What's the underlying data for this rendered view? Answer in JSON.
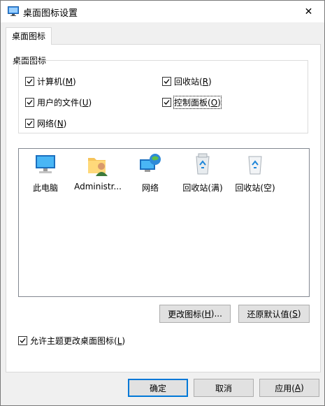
{
  "window": {
    "title": "桌面图标设置",
    "close_glyph": "✕"
  },
  "tabs": [
    {
      "label": "桌面图标"
    }
  ],
  "group": {
    "legend": "桌面图标",
    "checkboxes": [
      {
        "label": "计算机(",
        "key": "M",
        "tail": ")",
        "checked": true
      },
      {
        "label": "回收站(",
        "key": "R",
        "tail": ")",
        "checked": true
      },
      {
        "label": "用户的文件(",
        "key": "U",
        "tail": ")",
        "checked": true
      },
      {
        "label": "控制面板(",
        "key": "O",
        "tail": ")",
        "checked": true
      },
      {
        "label": "网络(",
        "key": "N",
        "tail": ")",
        "checked": true
      }
    ]
  },
  "icons": [
    {
      "label": "此电脑",
      "icon": "computer-icon"
    },
    {
      "label": "Administr...",
      "icon": "user-folder-icon"
    },
    {
      "label": "网络",
      "icon": "network-icon"
    },
    {
      "label": "回收站(满)",
      "icon": "recycle-bin-full-icon"
    },
    {
      "label": "回收站(空)",
      "icon": "recycle-bin-empty-icon"
    }
  ],
  "buttons": {
    "change_icon": {
      "label": "更改图标(",
      "key": "H",
      "tail": ")..."
    },
    "restore_default": {
      "label": "还原默认值(",
      "key": "S",
      "tail": ")"
    },
    "ok": {
      "label": "确定"
    },
    "cancel": {
      "label": "取消"
    },
    "apply": {
      "label": "应用(",
      "key": "A",
      "tail": ")"
    }
  },
  "theme_checkbox": {
    "label": "允许主题更改桌面图标(",
    "key": "L",
    "tail": ")",
    "checked": true
  },
  "colors": {
    "accent": "#0078d7",
    "window_bg": "#f0f0f0"
  }
}
